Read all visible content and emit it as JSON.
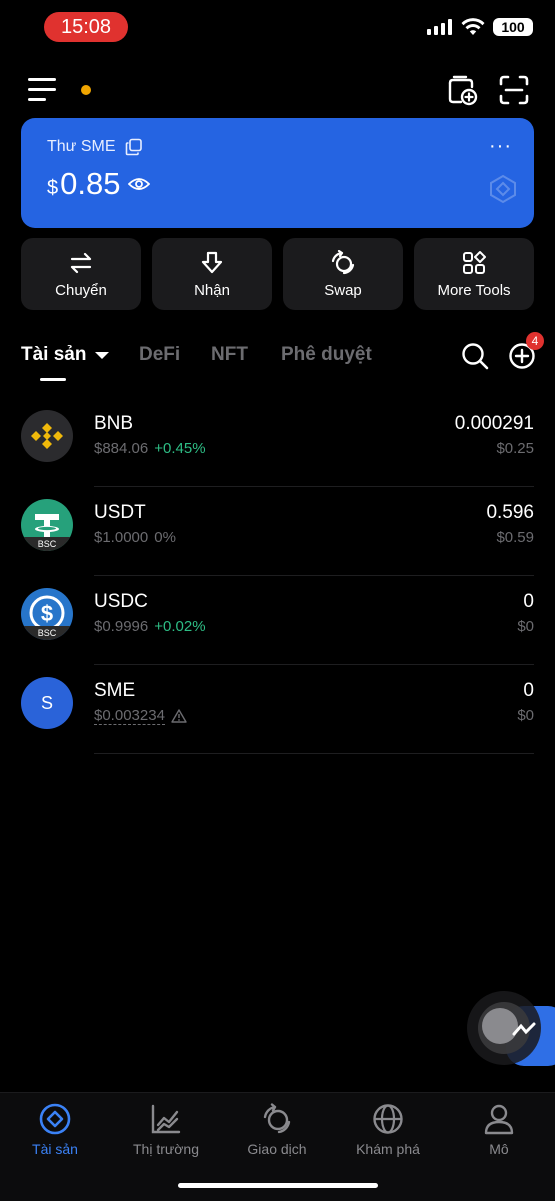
{
  "status": {
    "time": "15:08",
    "battery": "100"
  },
  "wallet": {
    "name": "Thư SME",
    "currency_symbol": "$",
    "balance": "0.85",
    "more": "···"
  },
  "actions": [
    {
      "label": "Chuyển",
      "icon": "transfer-icon"
    },
    {
      "label": "Nhận",
      "icon": "receive-icon"
    },
    {
      "label": "Swap",
      "icon": "swap-icon"
    },
    {
      "label": "More Tools",
      "icon": "more-tools-icon"
    }
  ],
  "tabs": [
    {
      "label": "Tài sản",
      "active": true
    },
    {
      "label": "DeFi"
    },
    {
      "label": "NFT"
    },
    {
      "label": "Phê duyệt"
    }
  ],
  "add_badge": "4",
  "tokens": [
    {
      "symbol": "BNB",
      "price": "$884.06",
      "change": "+0.45%",
      "amount": "0.000291",
      "value": "$0.25",
      "icon_color": "#2b2b2e"
    },
    {
      "symbol": "USDT",
      "price": "$1.0000",
      "change": "0%",
      "amount": "0.596",
      "value": "$0.59",
      "chain": "BSC",
      "icon_color": "#26a17b"
    },
    {
      "symbol": "USDC",
      "price": "$0.9996",
      "change": "+0.02%",
      "amount": "0",
      "value": "$0",
      "chain": "BSC",
      "icon_color": "#2775ca"
    },
    {
      "symbol": "SME",
      "price": "$0.003234",
      "change": "",
      "amount": "0",
      "value": "$0",
      "letter": "S",
      "icon_color": "#2a63d9"
    }
  ],
  "nav": [
    {
      "label": "Tài sản",
      "active": true
    },
    {
      "label": "Thị trường"
    },
    {
      "label": "Giao dịch"
    },
    {
      "label": "Khám phá"
    },
    {
      "label": "Mô"
    }
  ],
  "colors": {
    "accent": "#2564e2",
    "positive": "#2ebd85",
    "badge": "#e0322f",
    "nav_active": "#3b82f6"
  }
}
